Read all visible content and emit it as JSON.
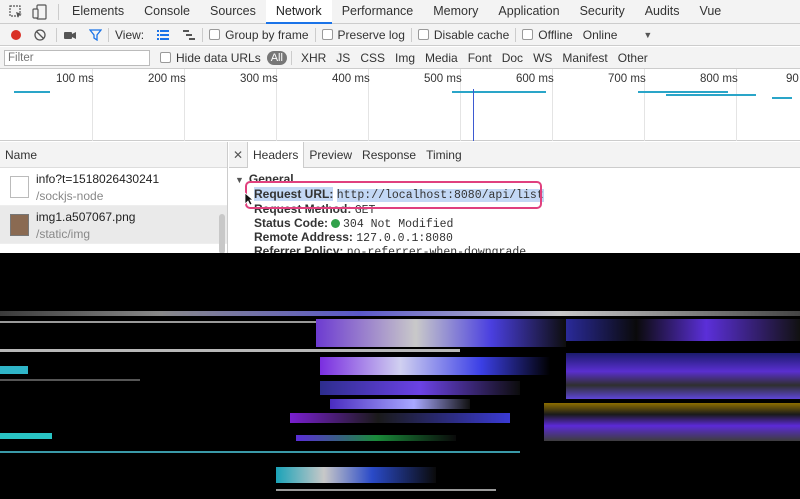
{
  "tabbar": {
    "tabs": [
      "Elements",
      "Console",
      "Sources",
      "Network",
      "Performance",
      "Memory",
      "Application",
      "Security",
      "Audits",
      "Vue"
    ],
    "active": "Network"
  },
  "toolbar": {
    "view_label": "View:",
    "group_by_frame": "Group by frame",
    "preserve_log": "Preserve log",
    "disable_cache": "Disable cache",
    "offline": "Offline",
    "throttle": "Online"
  },
  "filterbar": {
    "placeholder": "Filter",
    "hide_data_urls": "Hide data URLs",
    "types": [
      "All",
      "XHR",
      "JS",
      "CSS",
      "Img",
      "Media",
      "Font",
      "Doc",
      "WS",
      "Manifest",
      "Other"
    ]
  },
  "timeline": {
    "ticks": [
      "100 ms",
      "200 ms",
      "300 ms",
      "400 ms",
      "500 ms",
      "600 ms",
      "700 ms",
      "800 ms",
      "90"
    ]
  },
  "network_list": {
    "header": "Name",
    "requests": [
      {
        "name": "info?t=1518026430241",
        "path": "/sockjs-node"
      },
      {
        "name": "img1.a507067.png",
        "path": "/static/img"
      }
    ]
  },
  "detail": {
    "tabs": [
      "Headers",
      "Preview",
      "Response",
      "Timing"
    ],
    "active_tab": "Headers",
    "section": "General",
    "fields": {
      "request_url_key": "Request URL:",
      "request_url_val": "http://localhost:8080/api/list",
      "request_method_key": "Request Method:",
      "request_method_val": "GET",
      "status_code_key": "Status Code:",
      "status_code_val": "304 Not Modified",
      "remote_address_key": "Remote Address:",
      "remote_address_val": "127.0.0.1:8080",
      "referrer_policy_key": "Referrer Policy:",
      "referrer_policy_val": "no-referrer-when-downgrade"
    }
  },
  "colors": {
    "accent": "#1a73e8",
    "record": "#d93025",
    "highlight_box": "#e0407e",
    "status_ok": "#31a14a",
    "url_highlight": "#c3d8f5"
  }
}
